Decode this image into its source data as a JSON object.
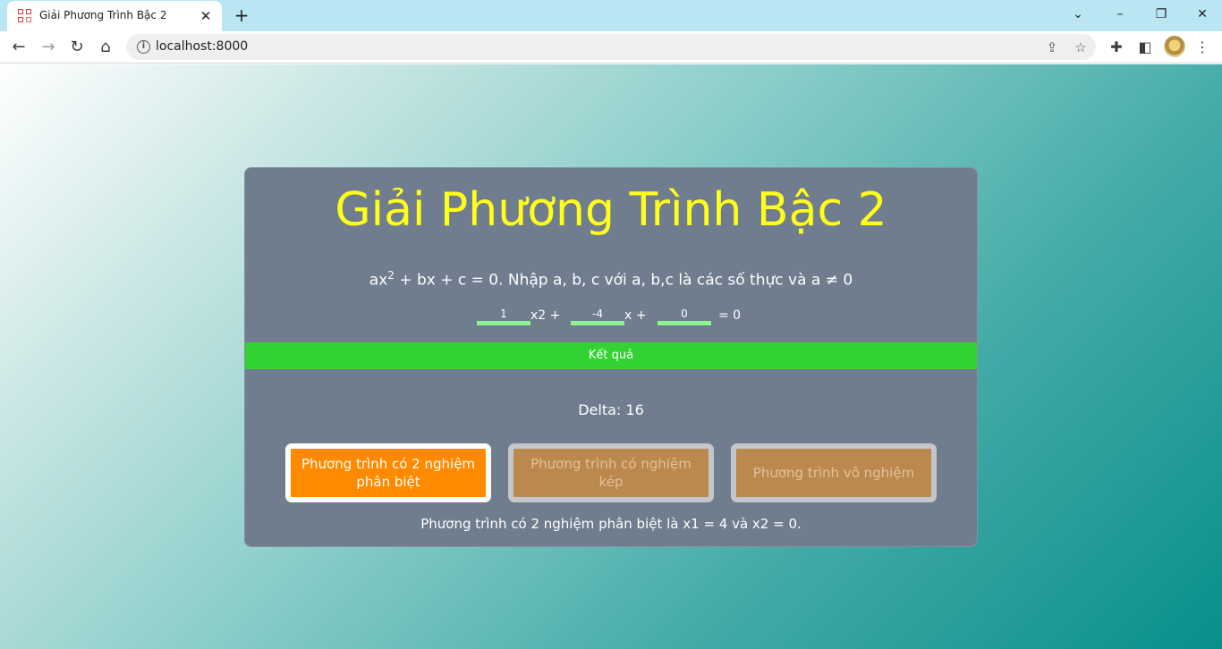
{
  "browser": {
    "tab_title": "Giải Phương Trình Bậc 2",
    "url": "localhost:8000"
  },
  "page": {
    "title": "Giải Phương Trình Bậc 2",
    "instruction_prefix": "ax",
    "instruction_sup": "2",
    "instruction_suffix": " + bx + c = 0. Nhập a, b, c với a, b,c là các số thực và a ≠ 0",
    "inputs": {
      "a": "1",
      "b": "-4",
      "c": "0"
    },
    "eq_x2": "x2  +",
    "eq_x": "x  +",
    "eq_equals": "=  0",
    "result_button": "Kết quả",
    "delta": "Delta: 16",
    "options": [
      "Phương trình có 2 nghiệm phân biệt",
      "Phương trình có nghiệm kép",
      "Phương trình vô nghiệm"
    ],
    "conclusion": "Phương trình có 2 nghiệm phân biệt là x1 = 4 và x2 = 0."
  },
  "colors": {
    "title": "#ffff1a",
    "card": "#6f7d8e",
    "result_button": "#31d231",
    "option_active": "#ff8a00",
    "option_inactive": "#bb884d",
    "input_underline": "#8ef58e"
  },
  "icons": [
    "qr-favicon-icon",
    "close-icon",
    "plus-icon",
    "chevron-down-icon",
    "minimize-icon",
    "restore-icon",
    "window-close-icon",
    "back-icon",
    "forward-icon",
    "reload-icon",
    "home-icon",
    "info-icon",
    "share-icon",
    "star-icon",
    "extensions-icon",
    "side-panel-icon",
    "avatar",
    "menu-icon"
  ]
}
